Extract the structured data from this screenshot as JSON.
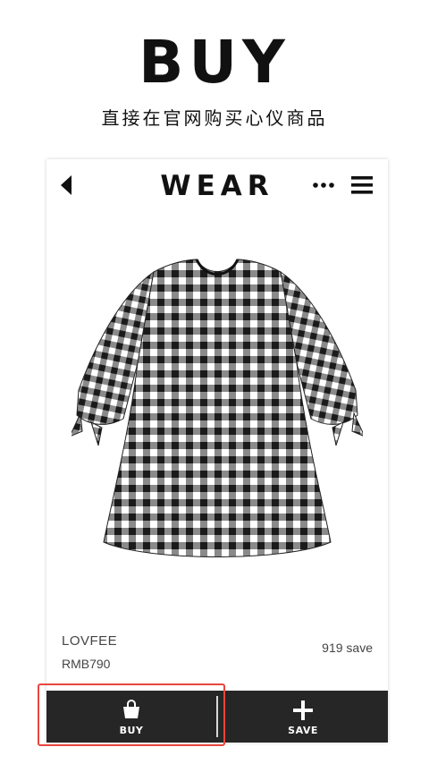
{
  "hero": {
    "title": "BUY",
    "subtitle": "直接在官网购买心仪商品"
  },
  "app": {
    "brand_title": "WEAR",
    "header_icons": [
      "back-arrow-icon",
      "more-dots-icon",
      "hamburger-menu-icon"
    ]
  },
  "product": {
    "brand": "LOVFEE",
    "price": "RMB790",
    "save_count": "919 save",
    "image": "gingham-check-blouse"
  },
  "actions": {
    "buy_label": "BUY",
    "save_label": "SAVE",
    "buy_icon": "shopping-bag-icon",
    "save_icon": "plus-icon"
  },
  "colors": {
    "action_bar": "#262626",
    "highlight": "#e8463f",
    "text": "#111111",
    "muted_text": "#444444"
  }
}
